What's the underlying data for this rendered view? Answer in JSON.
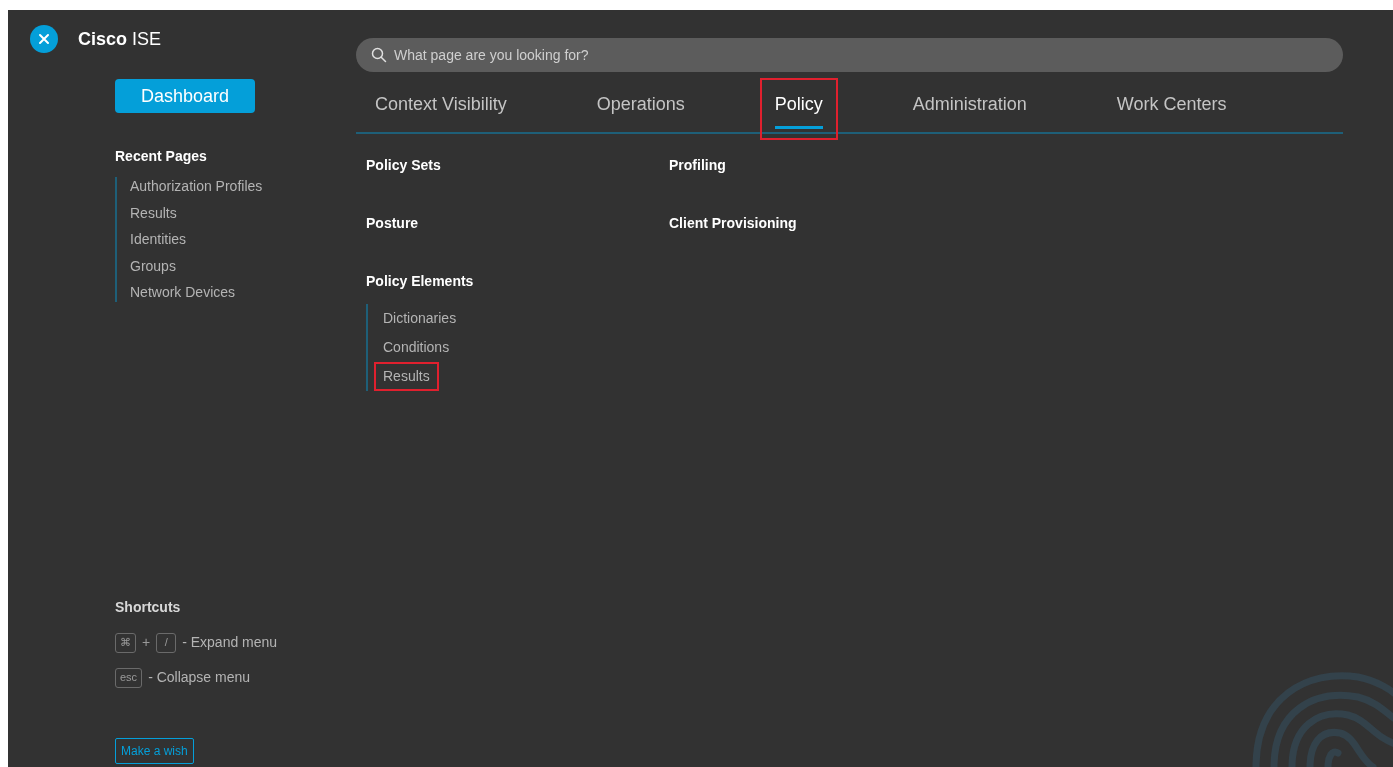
{
  "app": {
    "brand": "Cisco",
    "product": "ISE"
  },
  "search": {
    "placeholder": "What page are you looking for?"
  },
  "dashboard_button": "Dashboard",
  "tabs": [
    {
      "label": "Context Visibility",
      "selected": false,
      "highlighted": false
    },
    {
      "label": "Operations",
      "selected": false,
      "highlighted": false
    },
    {
      "label": "Policy",
      "selected": true,
      "highlighted": true
    },
    {
      "label": "Administration",
      "selected": false,
      "highlighted": false
    },
    {
      "label": "Work Centers",
      "selected": false,
      "highlighted": false
    }
  ],
  "recent_pages": {
    "title": "Recent Pages",
    "items": [
      "Authorization Profiles",
      "Results",
      "Identities",
      "Groups",
      "Network Devices"
    ]
  },
  "menu_columns": [
    {
      "sections": [
        {
          "title": "Policy Sets"
        },
        {
          "title": "Posture"
        },
        {
          "title": "Policy Elements",
          "children": [
            {
              "label": "Dictionaries",
              "highlighted": false
            },
            {
              "label": "Conditions",
              "highlighted": false
            },
            {
              "label": "Results",
              "highlighted": true
            }
          ]
        }
      ]
    },
    {
      "sections": [
        {
          "title": "Profiling"
        },
        {
          "title": "Client Provisioning"
        }
      ]
    }
  ],
  "shortcuts": {
    "title": "Shortcuts",
    "items": [
      {
        "parts": [
          {
            "kind": "key",
            "text": "⌘"
          },
          {
            "kind": "plus",
            "text": "+"
          },
          {
            "kind": "key",
            "text": "/"
          }
        ],
        "description": "- Expand menu"
      },
      {
        "parts": [
          {
            "kind": "key",
            "text": "esc"
          }
        ],
        "description": "- Collapse menu"
      }
    ]
  },
  "wish_button": "Make a wish"
}
